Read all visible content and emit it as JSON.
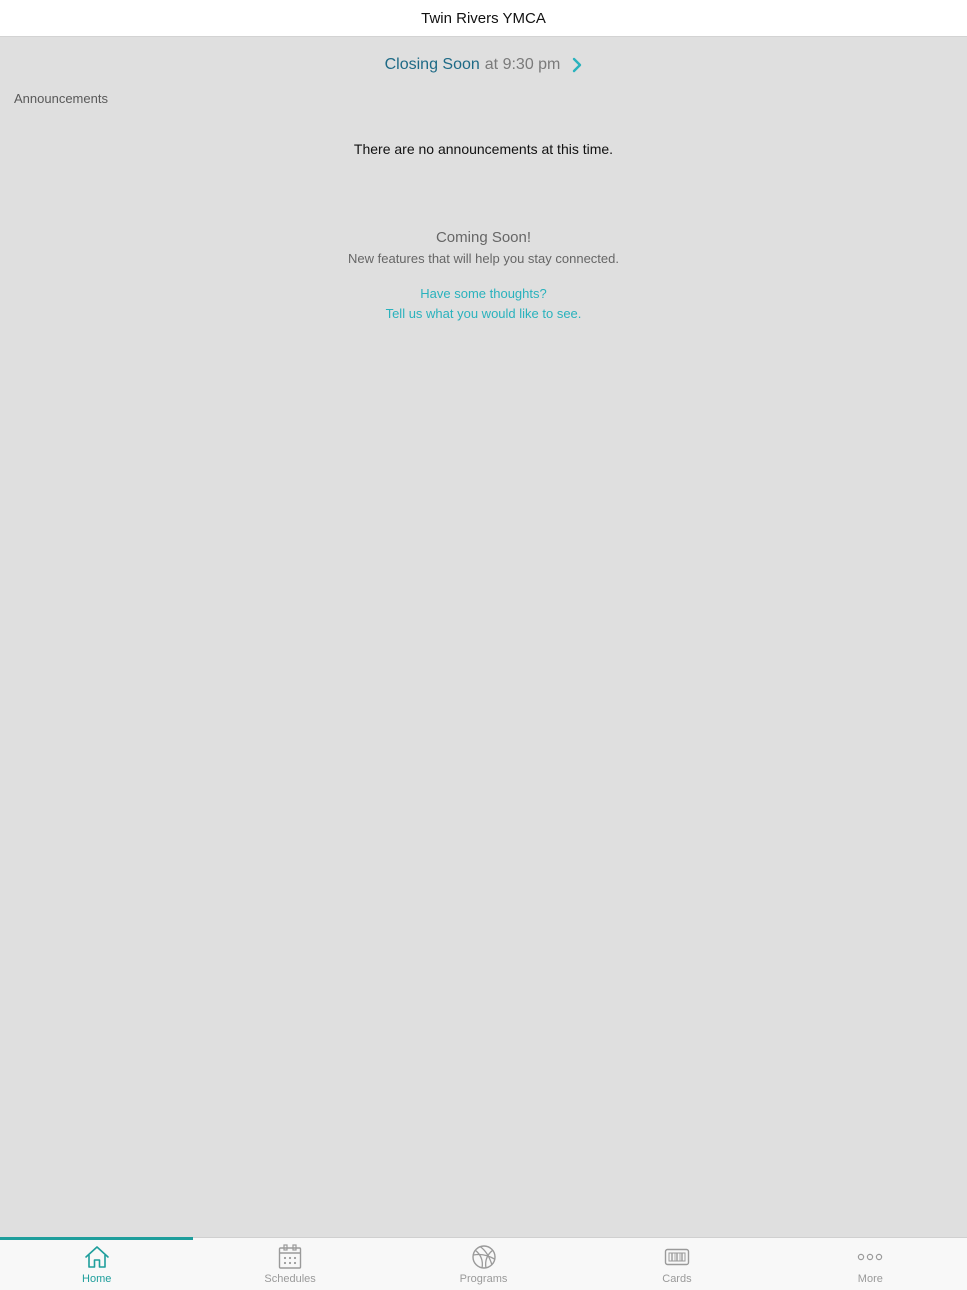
{
  "header": {
    "title": "Twin Rivers YMCA"
  },
  "hours": {
    "status": "Closing Soon",
    "time": "at 9:30 pm",
    "chevron_icon": "chevron-right-icon"
  },
  "announcements": {
    "label": "Announcements",
    "empty_message": "There are no announcements at this time."
  },
  "coming_soon": {
    "title": "Coming Soon!",
    "subtitle": "New features that will help you stay connected.",
    "feedback_line1": "Have some thoughts?",
    "feedback_line2": "Tell us what you would like to see."
  },
  "tabs": [
    {
      "label": "Home",
      "icon": "home-icon",
      "active": true
    },
    {
      "label": "Schedules",
      "icon": "calendar-icon",
      "active": false
    },
    {
      "label": "Programs",
      "icon": "basketball-icon",
      "active": false
    },
    {
      "label": "Cards",
      "icon": "card-icon",
      "active": false
    },
    {
      "label": "More",
      "icon": "more-icon",
      "active": false
    }
  ],
  "colors": {
    "accent": "#1e9e9c",
    "link": "#2ab2bd",
    "status": "#1e6a86",
    "background": "#dfdfdf",
    "inactive_tab": "#9a9a9a"
  }
}
